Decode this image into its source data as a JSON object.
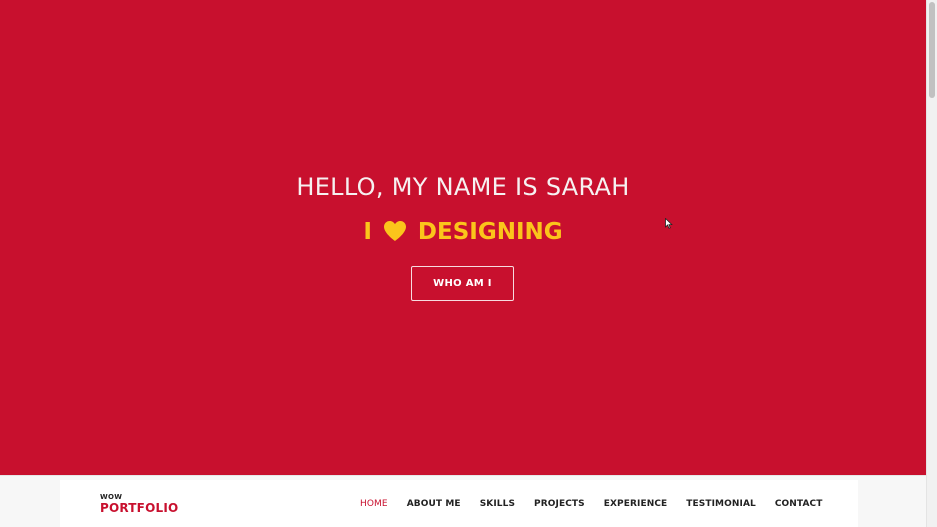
{
  "hero": {
    "greeting": "HELLO, MY NAME IS SARAH",
    "tagline_prefix": "I",
    "tagline_icon": "heart-icon",
    "tagline_suffix": "DESIGNING",
    "button_label": "WHO AM I",
    "colors": {
      "background": "#c8102e",
      "greeting": "#f6f1f1",
      "tagline": "#fbc51b"
    }
  },
  "navbar": {
    "brand_small": "WOW",
    "brand_main": "PORTFOLIO",
    "links": [
      {
        "label": "HOME",
        "active": true
      },
      {
        "label": "ABOUT ME",
        "active": false
      },
      {
        "label": "SKILLS",
        "active": false
      },
      {
        "label": "PROJECTS",
        "active": false
      },
      {
        "label": "EXPERIENCE",
        "active": false
      },
      {
        "label": "TESTIMONIAL",
        "active": false
      },
      {
        "label": "CONTACT",
        "active": false
      }
    ],
    "colors": {
      "accent": "#c8102e",
      "text": "#222222"
    }
  }
}
